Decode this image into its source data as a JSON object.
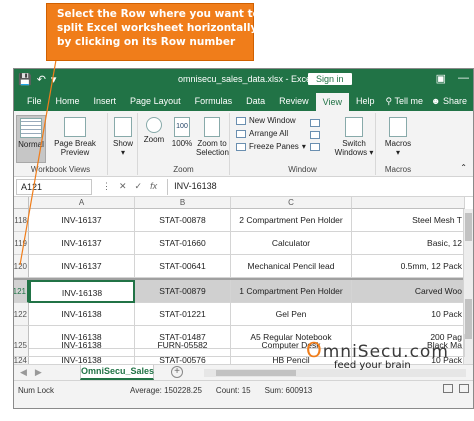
{
  "callout": {
    "lines": [
      "Select the Row where you want to",
      "split Excel worksheet horizontally",
      "by clicking on its Row number"
    ]
  },
  "titlebar": {
    "file_title": "omnisecu_sales_data.xlsx  -  Excel",
    "signin_label": "Sign in"
  },
  "tabs": [
    "File",
    "Home",
    "Insert",
    "Page Layout",
    "Formulas",
    "Data",
    "Review",
    "View",
    "Help"
  ],
  "active_tab": "View",
  "tell_me": "Tell me",
  "share": "Share",
  "ribbon": {
    "normal": "Normal",
    "page_break_preview_1": "Page Break",
    "page_break_preview_2": "Preview",
    "workbook_views_label": "Workbook Views",
    "show": "Show",
    "zoom": "Zoom",
    "zoom100": "100%",
    "zoom_to_1": "Zoom to",
    "zoom_to_2": "Selection",
    "zoom_group_label": "Zoom",
    "new_window": "New Window",
    "arrange_all": "Arrange All",
    "freeze_panes": "Freeze Panes",
    "switch_windows_1": "Switch",
    "switch_windows_2": "Windows",
    "window_group_label": "Window",
    "macros": "Macros",
    "macros_group_label": "Macros"
  },
  "formula_bar": {
    "name_box": "A121",
    "value": "INV-16138"
  },
  "columns": [
    "A",
    "B",
    "C"
  ],
  "rows": [
    {
      "num": "118",
      "a": "INV-16137",
      "b": "STAT-00878",
      "c": "2 Compartment Pen Holder",
      "d": "Steel Mesh T"
    },
    {
      "num": "119",
      "a": "INV-16137",
      "b": "STAT-01660",
      "c": "Calculator",
      "d": "Basic, 12"
    },
    {
      "num": "120",
      "a": "INV-16137",
      "b": "STAT-00641",
      "c": "Mechanical Pencil lead",
      "d": "0.5mm, 12 Pack"
    },
    {
      "num": "121",
      "a": "INV-16138",
      "b": "STAT-00879",
      "c": "1 Compartment Pen Holder",
      "d": "Carved Woo"
    },
    {
      "num": "122",
      "a": "INV-16138",
      "b": "STAT-01221",
      "c": "Gel Pen",
      "d": "10 Pack"
    },
    {
      "num": "123",
      "a": "INV-16138",
      "b": "STAT-01487",
      "c": "A5 Regular Notebook",
      "d": "200 Pag"
    },
    {
      "num": "124",
      "a": "INV-16138",
      "b": "STAT-00576",
      "c": "HB Pencil",
      "d": "10 Pack"
    },
    {
      "num": "125",
      "a": "INV-16138",
      "b": "FURN-05582",
      "c": "Computer Desk",
      "d": "Black Ma"
    }
  ],
  "selected_row": "121",
  "sheet_tab": "OmniSecu_Sales",
  "status": {
    "mode": "Num Lock",
    "average": "Average: 150228.25",
    "count": "Count: 15",
    "sum": "Sum: 600913"
  },
  "watermark": {
    "main_prefix": "O",
    "main_rest": "mniSecu.com",
    "tagline": "feed your brain"
  },
  "colors": {
    "excel_green": "#217346",
    "callout_orange": "#f07d1a"
  }
}
